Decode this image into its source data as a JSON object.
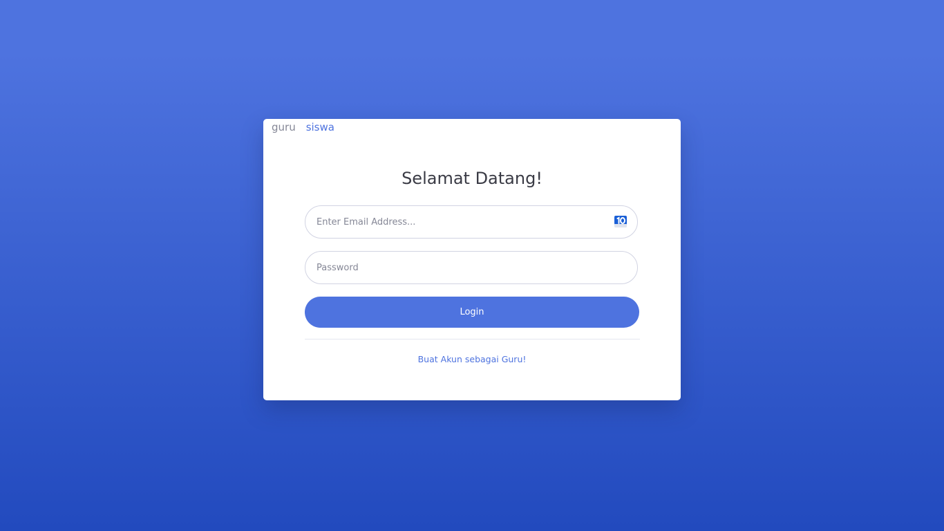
{
  "colors": {
    "background_top": "#4e73df",
    "background_bottom": "#224abe",
    "primary": "#4e73df",
    "card": "#ffffff",
    "text_dark": "#3a3b45",
    "text_muted": "#858796"
  },
  "tabs": [
    {
      "label": "guru",
      "active": false
    },
    {
      "label": "siswa",
      "active": true
    }
  ],
  "form": {
    "title": "Selamat Datang!",
    "email": {
      "value": "",
      "placeholder": "Enter Email Address...",
      "autofill_icon": "password-manager-icon"
    },
    "password": {
      "value": "",
      "placeholder": "Password"
    },
    "login_label": "Login",
    "register_link": "Buat Akun sebagai Guru!"
  }
}
